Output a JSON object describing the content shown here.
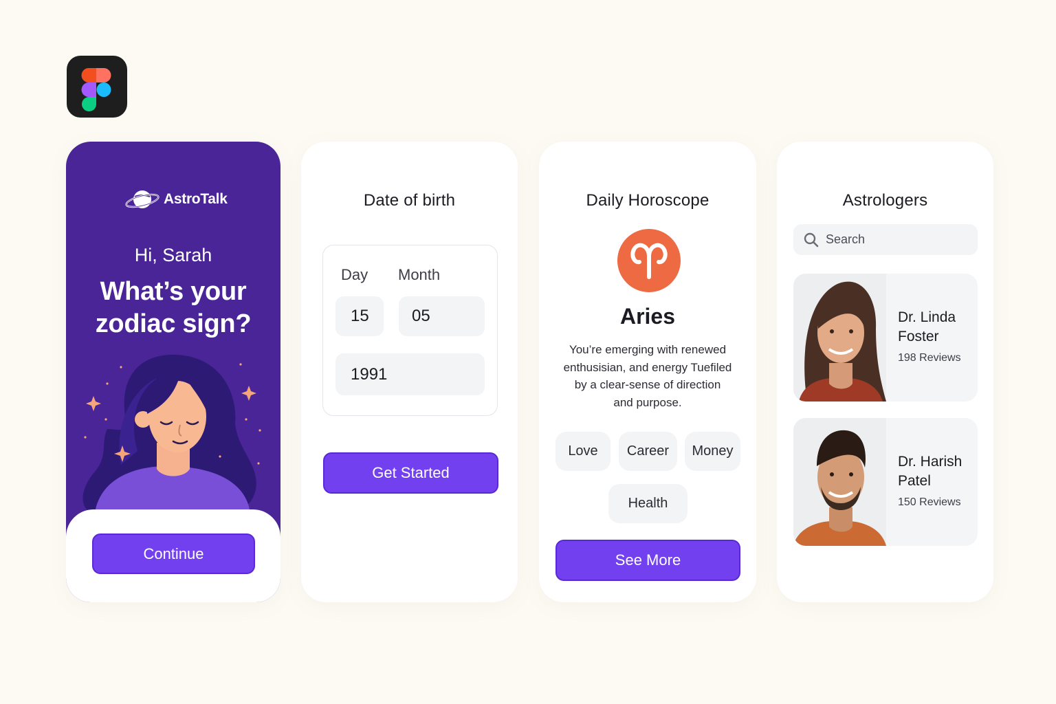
{
  "colors": {
    "background": "#fdfaf4",
    "purple_dark": "#4a2597",
    "button_purple": "#7340f0",
    "aries_orange": "#ee6a43",
    "field_gray": "#f3f4f6"
  },
  "icons": {
    "app_logo": "figma-icon",
    "brand_logo": "planet-icon",
    "zodiac": "aries-icon",
    "search": "search-icon"
  },
  "welcome": {
    "brand_name": "AstroTalk",
    "greeting": "Hi, Sarah",
    "question_line1": "What’s your",
    "question_line2": "zodiac sign?",
    "continue_label": "Continue"
  },
  "dob": {
    "title": "Date of birth",
    "day_label": "Day",
    "month_label": "Month",
    "day_value": "15",
    "month_value": "05",
    "year_value": "1991",
    "button_label": "Get Started"
  },
  "horoscope": {
    "title": "Daily Horoscope",
    "sign": "Aries",
    "text_lines": [
      "You’re emerging with renewed",
      "enthusisian, and energy Tuefiled",
      "by a clear-sense of direction",
      "and purpose."
    ],
    "chips": [
      "Love",
      "Career",
      "Money",
      "Health"
    ],
    "button_label": "See More"
  },
  "astrologers": {
    "title": "Astrologers",
    "search_placeholder": "Search",
    "list": [
      {
        "name_line1": "Dr. Linda",
        "name_line2": "Foster",
        "reviews": "198 Reviews"
      },
      {
        "name_line1": "Dr. Harish",
        "name_line2": "Patel",
        "reviews": "150 Reviews"
      }
    ]
  }
}
